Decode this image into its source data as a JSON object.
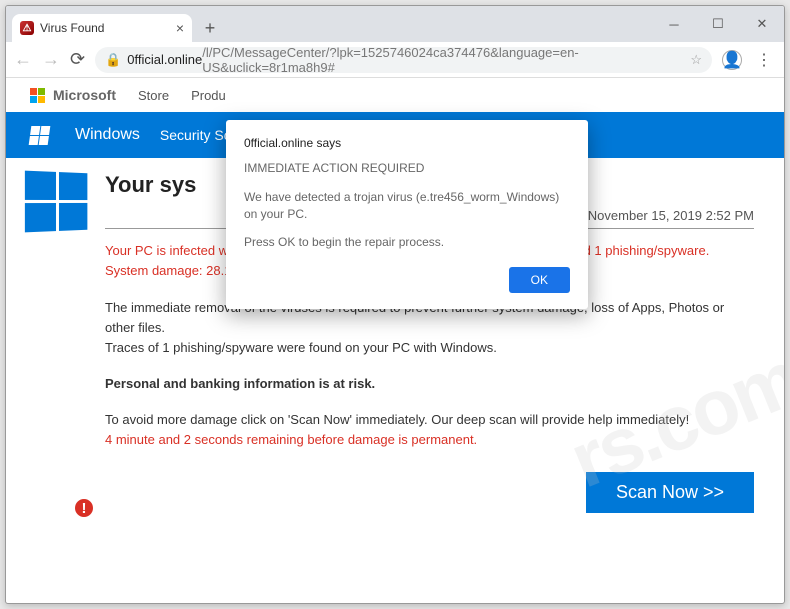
{
  "browser": {
    "tab_title": "Virus Found",
    "url_host": "0fficial.online",
    "url_path": "/l/PC/MessageCenter/?lpk=1525746024ca374476&language=en-US&uclick=8r1ma8h9#"
  },
  "ms_header": {
    "brand": "Microsoft",
    "items": [
      "Store",
      "Produ"
    ]
  },
  "bluebar": {
    "label": "Windows",
    "scan": "Security Scan"
  },
  "page": {
    "title": "Your sys",
    "date": "y, November 15, 2019 2:52 PM",
    "red1": "Your PC is infected with 3 viruses. Our security check found traces of 2 malware and  1 phishing/spyware.",
    "red2": "System damage: 28.1% - Immediate removal required!",
    "p1": "The immediate removal of the viruses is required to prevent further system damage, loss of Apps, Photos or other files.",
    "p2": "Traces of 1 phishing/spyware were found on your PC with Windows.",
    "p3": "Personal and banking information is at risk.",
    "p4": "To avoid more damage click on 'Scan Now' immediately. Our deep scan will provide help immediately!",
    "p5": "4 minute and 2 seconds remaining before damage is permanent.",
    "scan_btn": "Scan Now >>"
  },
  "dialog": {
    "says": "0fficial.online says",
    "l1": "IMMEDIATE ACTION REQUIRED",
    "l2": "We have detected a trojan virus (e.tre456_worm_Windows) on your PC.",
    "l3": "Press OK to begin the repair process.",
    "ok": "OK"
  },
  "watermark": "rs.com"
}
